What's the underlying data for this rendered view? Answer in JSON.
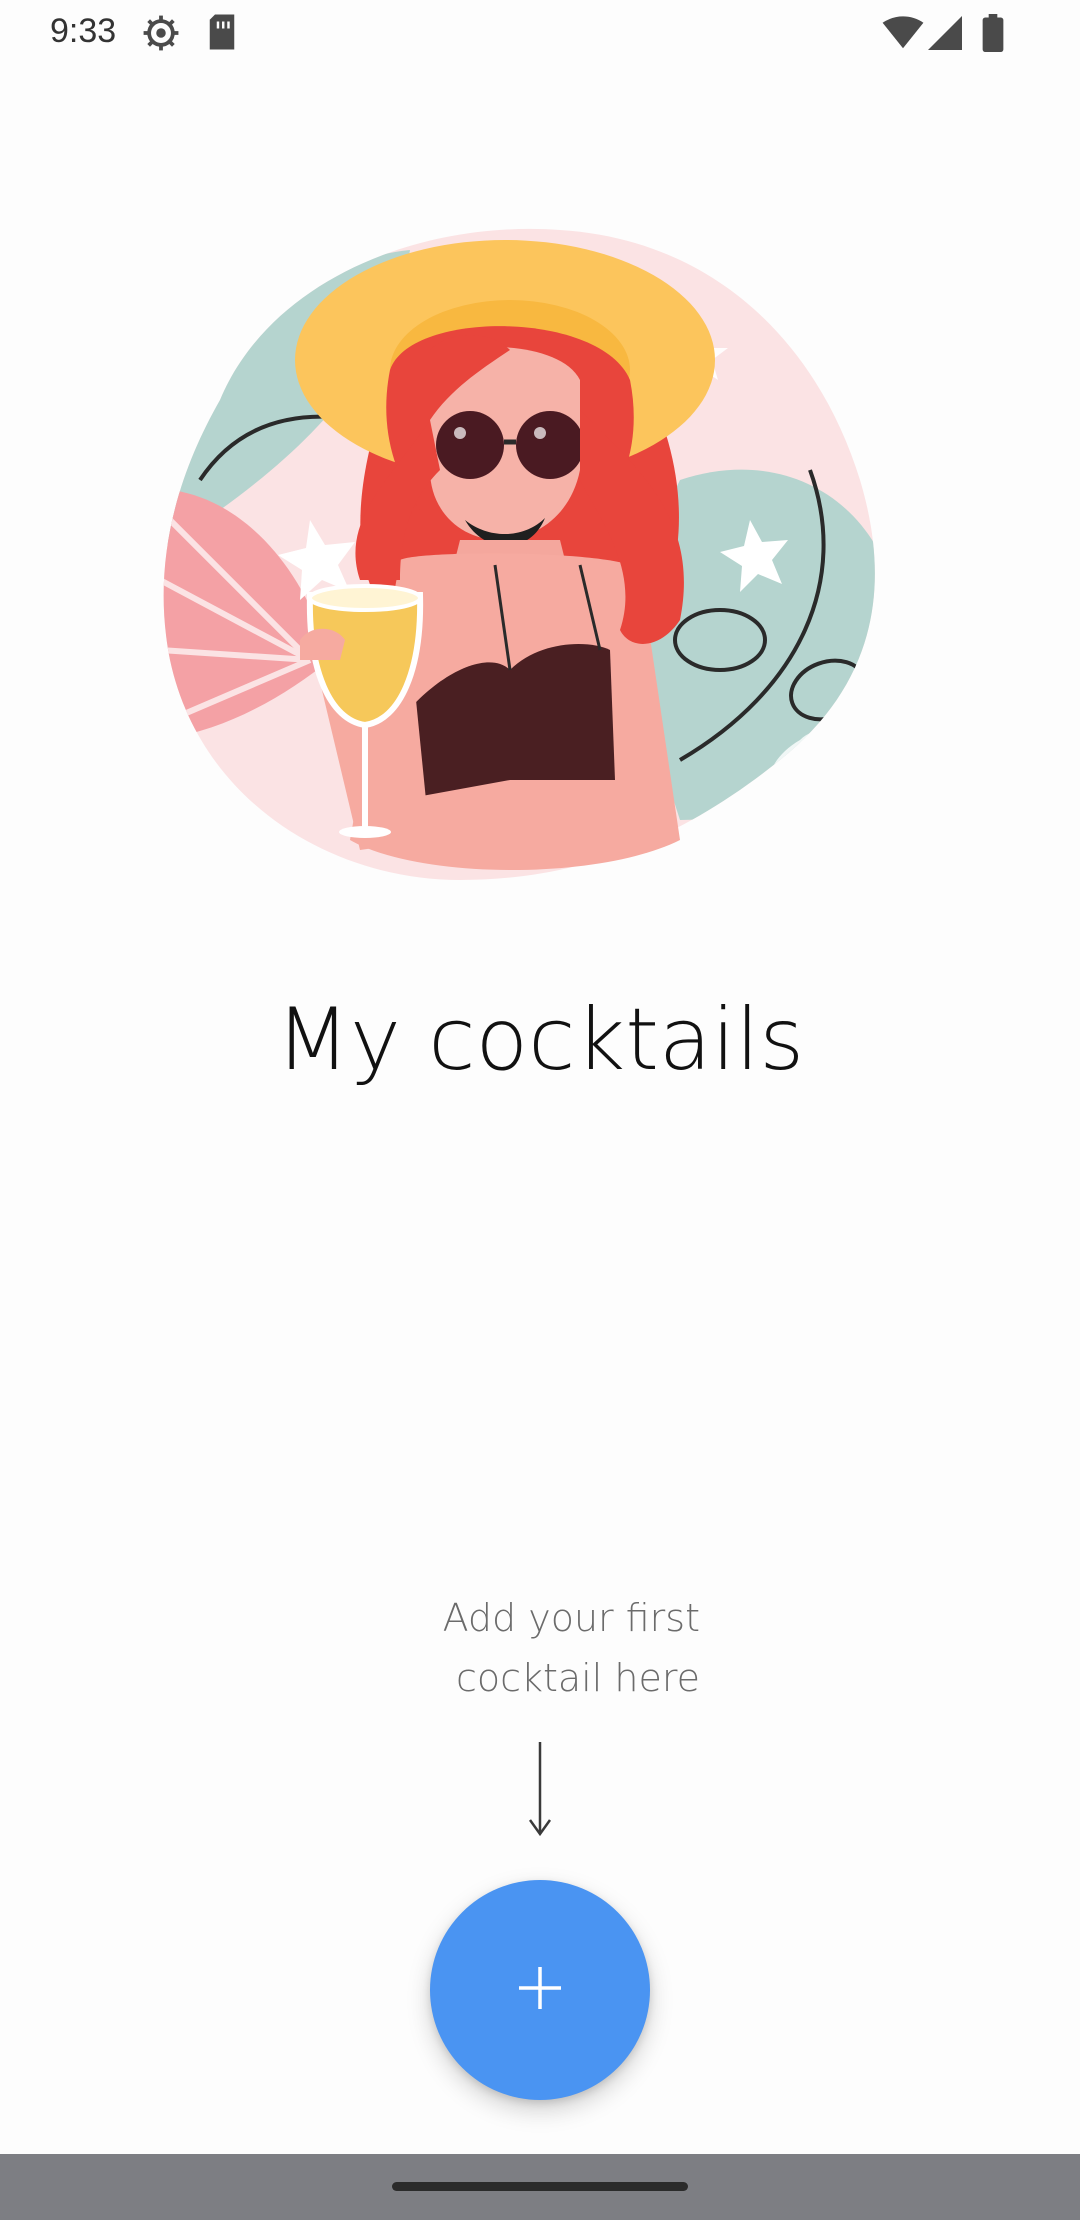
{
  "status_bar": {
    "time": "9:33",
    "icons": [
      "settings-icon",
      "sim-card-icon",
      "wifi-icon",
      "signal-icon",
      "battery-icon"
    ]
  },
  "main": {
    "illustration": "woman-with-cocktail-illustration",
    "title": "My cocktails",
    "hint_line_1": "Add your first",
    "hint_line_2": "cocktail here",
    "fab_icon": "plus-icon"
  },
  "colors": {
    "fab": "#4a94f2",
    "title": "#111111",
    "hint": "#6b6b6b",
    "background": "#fdfdfd",
    "nav_bar": "#7d7e83"
  }
}
